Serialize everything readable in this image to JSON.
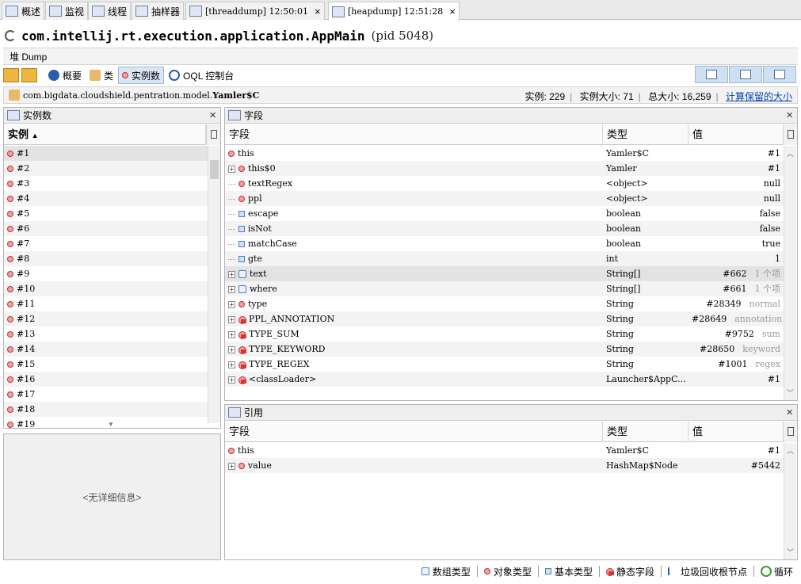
{
  "tabs": [
    {
      "label": "概述",
      "icon": "overview-icon"
    },
    {
      "label": "监视",
      "icon": "monitor-icon"
    },
    {
      "label": "线程",
      "icon": "threads-icon"
    },
    {
      "label": "抽样器",
      "icon": "sampler-icon"
    },
    {
      "label": "[threaddump] 12:50:01",
      "icon": "threaddump-icon",
      "closable": true
    },
    {
      "label": "[heapdump] 12:51:28",
      "icon": "heapdump-icon",
      "closable": true,
      "active": true
    }
  ],
  "title": {
    "main": "com.intellij.rt.execution.application.AppMain",
    "pid": "(pid 5048)"
  },
  "dump_label": "堆 Dump",
  "toolbar": {
    "summary": "概要",
    "classes": "类",
    "instances": "实例数",
    "oql": "OQL 控制台"
  },
  "classbar": {
    "prefix": "com.bigdata.cloudshield.pentration.model.",
    "classname": "Yamler$C",
    "instances": "实例: 229",
    "instance_size": "实例大小: 71",
    "total_size": "总大小: 16,259",
    "retained_link": "计算保留的大小"
  },
  "instances_panel": {
    "title": "实例数",
    "header": "实例",
    "items": [
      "#1",
      "#2",
      "#3",
      "#4",
      "#5",
      "#6",
      "#7",
      "#8",
      "#9",
      "#10",
      "#11",
      "#12",
      "#13",
      "#14",
      "#15",
      "#16",
      "#17",
      "#18",
      "#19"
    ]
  },
  "no_detail": "<无详细信息>",
  "fields_panel": {
    "title": "字段",
    "headers": {
      "field": "字段",
      "type": "类型",
      "value": "值"
    },
    "rows": [
      {
        "name": "this",
        "kind": "object",
        "tree": "root",
        "type": "Yamler$C",
        "value": "#1",
        "extra": ""
      },
      {
        "name": "this$0",
        "kind": "object",
        "tree": "expand",
        "type": "Yamler",
        "value": "#1",
        "extra": ""
      },
      {
        "name": "textRegex",
        "kind": "object",
        "tree": "leaf",
        "type": "<object>",
        "value": "null",
        "extra": ""
      },
      {
        "name": "ppl",
        "kind": "object",
        "tree": "leaf",
        "type": "<object>",
        "value": "null",
        "extra": ""
      },
      {
        "name": "escape",
        "kind": "primitive",
        "tree": "leaf",
        "type": "boolean",
        "value": "false",
        "extra": ""
      },
      {
        "name": "isNot",
        "kind": "primitive",
        "tree": "leaf",
        "type": "boolean",
        "value": "false",
        "extra": ""
      },
      {
        "name": "matchCase",
        "kind": "primitive",
        "tree": "leaf",
        "type": "boolean",
        "value": "true",
        "extra": ""
      },
      {
        "name": "gte",
        "kind": "primitive",
        "tree": "leaf",
        "type": "int",
        "value": "1",
        "extra": ""
      },
      {
        "name": "text",
        "kind": "array",
        "tree": "expand",
        "type": "String[]",
        "value": "#662",
        "extra": "1 个项"
      },
      {
        "name": "where",
        "kind": "array",
        "tree": "expand",
        "type": "String[]",
        "value": "#661",
        "extra": "1 个项"
      },
      {
        "name": "type",
        "kind": "object",
        "tree": "expand",
        "type": "String",
        "value": "#28349",
        "extra": "normal"
      },
      {
        "name": "PPL_ANNOTATION",
        "kind": "static",
        "tree": "expand",
        "type": "String",
        "value": "#28649",
        "extra": "annotation"
      },
      {
        "name": "TYPE_SUM",
        "kind": "static",
        "tree": "expand",
        "type": "String",
        "value": "#9752",
        "extra": "sum"
      },
      {
        "name": "TYPE_KEYWORD",
        "kind": "static",
        "tree": "expand",
        "type": "String",
        "value": "#28650",
        "extra": "keyword"
      },
      {
        "name": "TYPE_REGEX",
        "kind": "static",
        "tree": "expand",
        "type": "String",
        "value": "#1001",
        "extra": "regex"
      },
      {
        "name": "<classLoader>",
        "kind": "static",
        "tree": "expand",
        "type": "Launcher$AppC...",
        "value": "#1",
        "extra": ""
      }
    ]
  },
  "refs_panel": {
    "title": "引用",
    "headers": {
      "field": "字段",
      "type": "类型",
      "value": "值"
    },
    "rows": [
      {
        "name": "this",
        "kind": "object",
        "tree": "root",
        "type": "Yamler$C",
        "value": "#1"
      },
      {
        "name": "value",
        "kind": "object",
        "tree": "expand",
        "type": "HashMap$Node",
        "value": "#5442"
      }
    ]
  },
  "legend": [
    "数组类型",
    "对象类型",
    "基本类型",
    "静态字段",
    "垃圾回收根节点",
    "循环"
  ]
}
